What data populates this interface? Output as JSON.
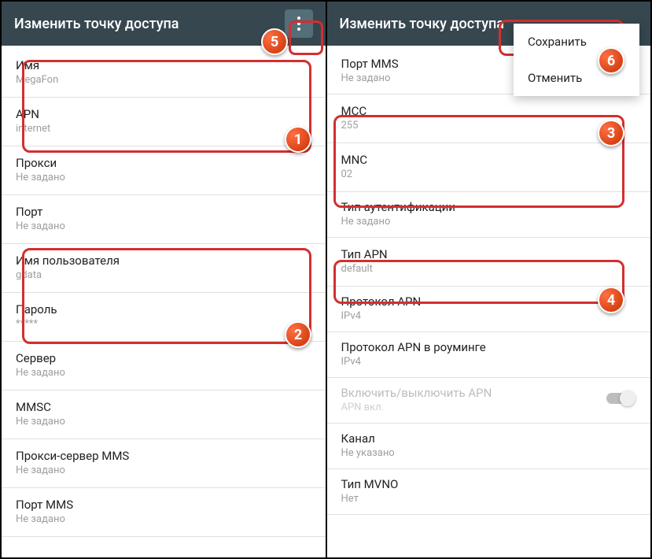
{
  "left": {
    "title": "Изменить точку доступа",
    "rows": [
      {
        "label": "Имя",
        "value": "MegaFon"
      },
      {
        "label": "APN",
        "value": "internet"
      },
      {
        "label": "Прокси",
        "value": "Не задано"
      },
      {
        "label": "Порт",
        "value": "Не задано"
      },
      {
        "label": "Имя пользователя",
        "value": "gdata"
      },
      {
        "label": "Пароль",
        "value": "*****"
      },
      {
        "label": "Сервер",
        "value": "Не задано"
      },
      {
        "label": "MMSC",
        "value": "Не задано"
      },
      {
        "label": "Прокси-сервер MMS",
        "value": "Не задано"
      },
      {
        "label": "Порт MMS",
        "value": "Не задано"
      }
    ]
  },
  "right": {
    "title": "Изменить точку доступа",
    "menu": {
      "save": "Сохранить",
      "cancel": "Отменить"
    },
    "rows": [
      {
        "label": "Порт MMS",
        "value": "Не задано"
      },
      {
        "label": "MCC",
        "value": "255"
      },
      {
        "label": "MNC",
        "value": "02"
      },
      {
        "label": "Тип аутентификации",
        "value": "Не задано"
      },
      {
        "label": "Тип APN",
        "value": "default"
      },
      {
        "label": "Протокол APN",
        "value": "IPv4"
      },
      {
        "label": "Протокол APN в роуминге",
        "value": "IPv4"
      },
      {
        "label": "Включить/выключить APN",
        "value": "APN вкл.",
        "disabled": true,
        "toggle": true
      },
      {
        "label": "Канал",
        "value": "Не указано"
      },
      {
        "label": "Тип MVNO",
        "value": "Нет"
      }
    ]
  },
  "badges": {
    "b1": "1",
    "b2": "2",
    "b3": "3",
    "b4": "4",
    "b5": "5",
    "b6": "6"
  }
}
